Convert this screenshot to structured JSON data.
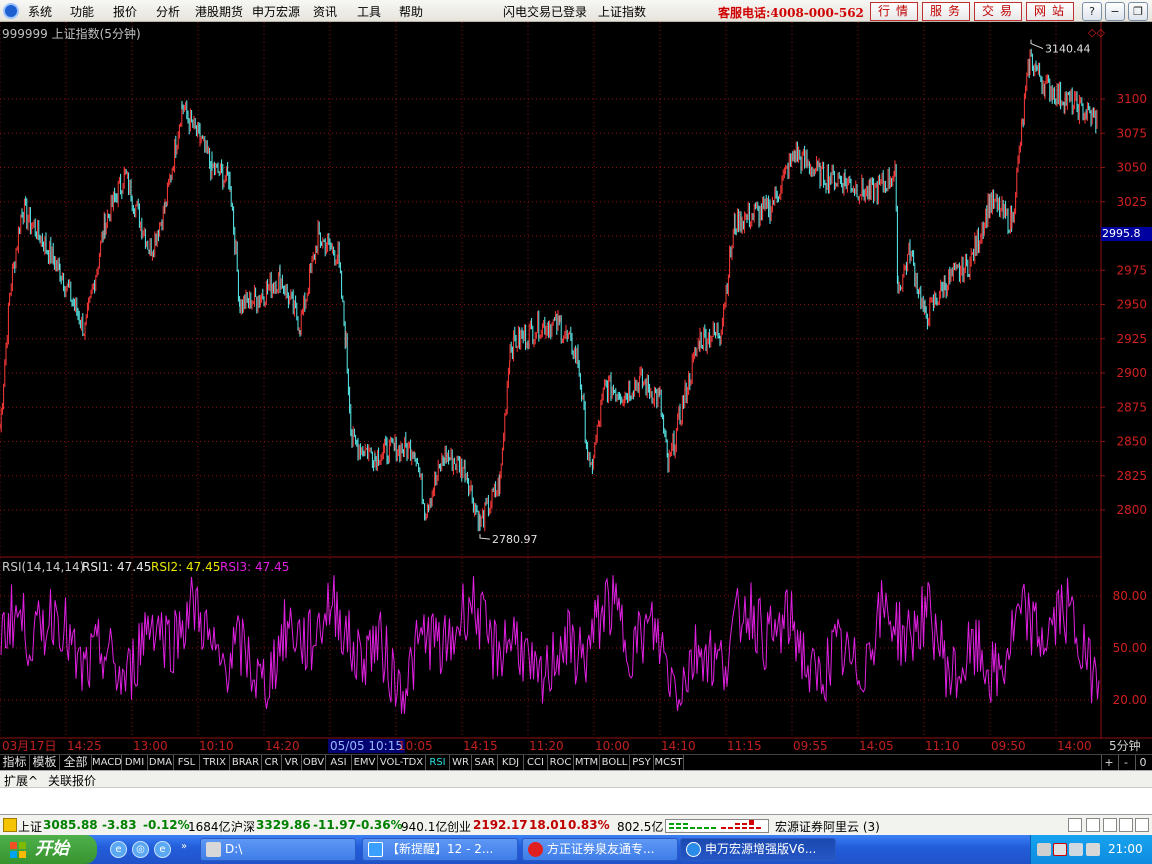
{
  "menu": {
    "items": [
      "系统",
      "功能",
      "报价",
      "分析",
      "港股期货",
      "申万宏源",
      "资讯",
      "工具",
      "帮助"
    ],
    "login_status": "闪电交易已登录",
    "current_index": "上证指数",
    "hotline": "客服电话:4008-000-562",
    "buttons": [
      "行情",
      "服务",
      "交易",
      "网站"
    ],
    "window_controls": [
      "?",
      "−",
      "❐",
      "✕"
    ]
  },
  "chart": {
    "title": "999999 上证指数(5分钟)",
    "price_ticks": [
      "3100",
      "3075",
      "3050",
      "3025",
      "2975",
      "2950",
      "2925",
      "2900",
      "2875",
      "2850",
      "2825",
      "2800"
    ],
    "current_price": "2995.8",
    "high_label": "3140.44",
    "low_label": "2780.97",
    "price_color": "#5cf0f0",
    "grid_color": "#8b1010",
    "indicator_symbol": "◇◇"
  },
  "rsi": {
    "header": "RSI(14,14,14)",
    "rsi1": "RSI1: 47.45",
    "rsi2": "RSI2: 47.45",
    "rsi3": "RSI3: 47.45",
    "ticks": [
      "80.00",
      "50.00",
      "20.00"
    ],
    "color": "#e020e0"
  },
  "time_axis": {
    "labels": [
      "03月17日",
      "14:25",
      "13:00",
      "10:10",
      "14:20",
      "05/05 10:15",
      "10:05",
      "14:15",
      "11:20",
      "10:00",
      "14:10",
      "11:15",
      "09:55",
      "14:05",
      "11:10",
      "09:50",
      "14:00"
    ],
    "period": "5分钟"
  },
  "indicator_tabs": [
    "指标",
    "模板",
    "全部",
    "MACD",
    "DMI",
    "DMA",
    "FSL",
    "TRIX",
    "BRAR",
    "CR",
    "VR",
    "OBV",
    "ASI",
    "EMV",
    "VOL-TDX",
    "RSI",
    "WR",
    "SAR",
    "KDJ",
    "CCI",
    "ROC",
    "MTM",
    "BOLL",
    "PSY",
    "MCST"
  ],
  "indicator_active": "RSI",
  "tab_controls": [
    "+",
    "-",
    "0"
  ],
  "ext_row": [
    "扩展^",
    "关联报价"
  ],
  "indices": {
    "sh_name": "上证",
    "sh_value": "3085.88",
    "sh_change": "-3.83",
    "sh_pct": "-0.12%",
    "sh_amount": "1684亿",
    "hs_name": "沪深",
    "hs_value": "3329.86",
    "hs_change": "-11.97",
    "hs_pct": "-0.36%",
    "hs_amount": "940.1亿",
    "cy_name": "创业",
    "cy_value": "2192.17",
    "cy_change": "18.01",
    "cy_pct": "0.83%",
    "cy_amount": "802.5亿",
    "server": "宏源证券阿里云 (3)"
  },
  "taskbar": {
    "start": "开始",
    "tasks": [
      "D:\\",
      "【新提醒】12 - 2...",
      "方正证券泉友通专...",
      "申万宏源增强版V6..."
    ],
    "clock": "21:00"
  }
}
